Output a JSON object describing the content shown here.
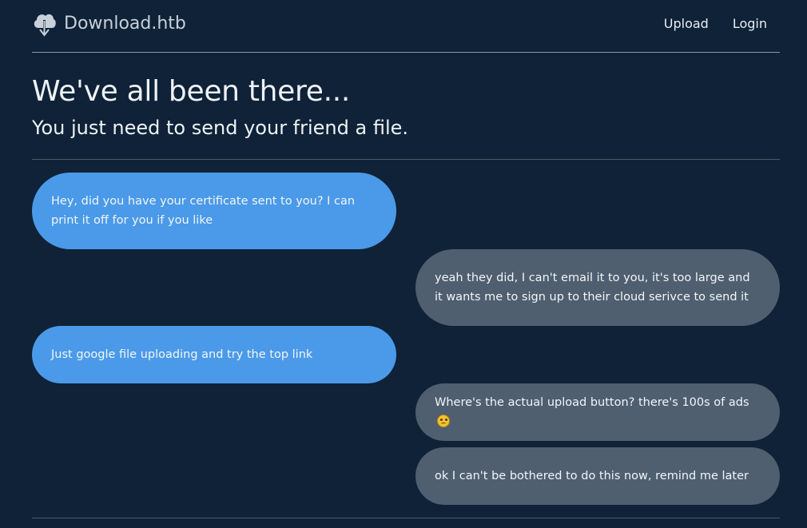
{
  "navbar": {
    "brand": "Download.htb",
    "brand_icon": "cloud-download-icon",
    "links": [
      {
        "label": "Upload"
      },
      {
        "label": "Login"
      }
    ]
  },
  "hero": {
    "title": "We've all been there...",
    "subtitle": "You just need to send your friend a file."
  },
  "chat": {
    "messages": [
      {
        "side": "left",
        "text": "Hey, did you have your certificate sent to you? I can print it off for you if you like"
      },
      {
        "side": "right",
        "text": "yeah they did, I can't email it to you, it's too large and it wants me to sign up to their cloud serivce to send it"
      },
      {
        "side": "left",
        "text": "Just google file uploading and try the top link"
      },
      {
        "side": "right",
        "text": "Where's the actual upload button? there's 100s of ads",
        "emoji": "woozy-face-icon"
      },
      {
        "side": "right",
        "text": "ok I can't be bothered to do this now, remind me later"
      }
    ]
  },
  "colors": {
    "background": "#0f2237",
    "friend_bubble": "#4a9ae9",
    "user_bubble": "#4f5f70",
    "divider": "#4b5a6a"
  }
}
